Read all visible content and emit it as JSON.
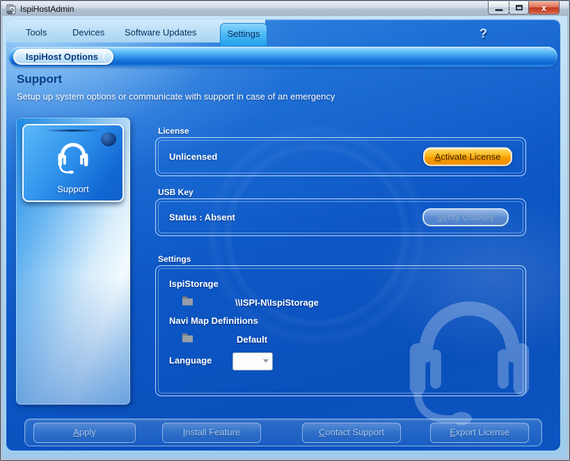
{
  "window": {
    "title": "IspiHostAdmin"
  },
  "window_controls": {
    "minimize": "minimize",
    "maximize": "maximize",
    "close": "close"
  },
  "tabs": [
    {
      "label": "Tools",
      "active": false
    },
    {
      "label": "Devices",
      "active": false
    },
    {
      "label": "Software Updates",
      "active": false
    },
    {
      "label": "Settings",
      "active": true
    }
  ],
  "help": {
    "label": "?"
  },
  "breadcrumb": {
    "label": "IspiHost Options"
  },
  "header": {
    "title": "Support",
    "subtitle": "Setup up system options or communicate with support in case of an emergency"
  },
  "sidebar": {
    "items": [
      {
        "label": "Support",
        "icon": "headset-icon",
        "selected": true
      }
    ]
  },
  "sections": {
    "license": {
      "label": "License",
      "status": "Unlicensed",
      "button": "Activate License"
    },
    "usb_key": {
      "label": "USB Key",
      "status": "Status : Absent",
      "button": "Verify UsbKey"
    },
    "settings": {
      "label": "Settings",
      "ispistorage_label": "IspiStorage",
      "ispistorage_path": "\\\\ISPI-N\\IspiStorage",
      "navi_label": "Navi Map Definitions",
      "navi_value": "Default",
      "language_label": "Language",
      "language_value": ""
    }
  },
  "footer": {
    "buttons": [
      {
        "label": "Apply"
      },
      {
        "label": "Install Feature"
      },
      {
        "label": "Contact Support"
      },
      {
        "label": "Export License"
      }
    ]
  },
  "colors": {
    "accent_orange": "#f59b00",
    "panel_blue": "#0d55c2",
    "tab_active_blue": "#2aa6f0",
    "navy_text": "#0a3060",
    "close_red": "#c23c24"
  }
}
